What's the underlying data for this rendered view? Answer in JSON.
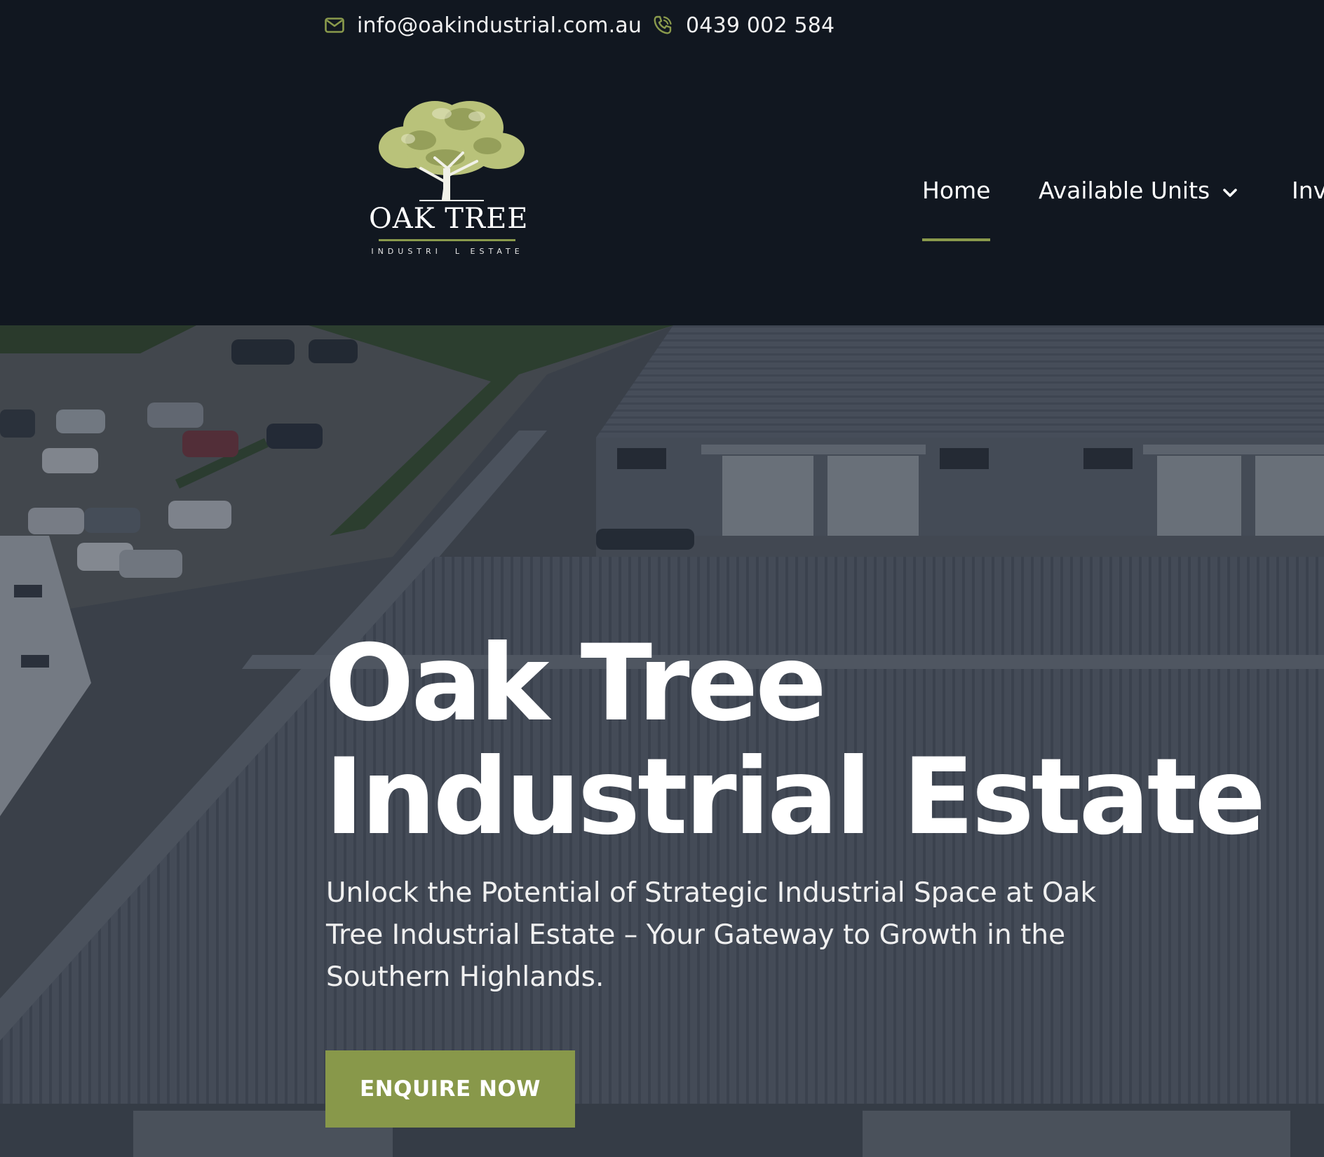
{
  "contact": {
    "email": "info@oakindustrial.com.au",
    "phone": "0439 002 584"
  },
  "logo": {
    "title": "OAK TREE",
    "subtitle": "INDUSTRI  L ESTATE"
  },
  "nav": {
    "items": [
      {
        "label": "Home",
        "active": true
      },
      {
        "label": "Available Units",
        "has_dropdown": true
      },
      {
        "label": "Inv"
      }
    ]
  },
  "hero": {
    "title_line1": "Oak Tree",
    "title_line2": "Industrial Estate",
    "subtitle": "Unlock the Potential of Strategic Industrial Space at Oak Tree Industrial Estate – Your Gateway to Growth in the Southern Highlands.",
    "cta_label": "ENQUIRE NOW"
  },
  "colors": {
    "background": "#111720",
    "accent": "#88984a",
    "text": "#ffffff"
  },
  "icons": [
    "email-icon",
    "phone-icon",
    "chevron-down-icon",
    "oak-tree-logo-icon"
  ]
}
